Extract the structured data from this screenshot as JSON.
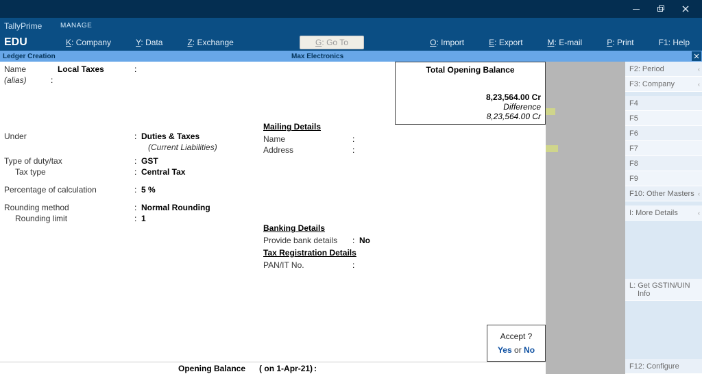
{
  "titlebar": {
    "app": "TallyPrime",
    "edition": "EDU"
  },
  "topnav": {
    "manage": "MANAGE",
    "items": {
      "company": "Company",
      "data": "Data",
      "exchange": "Exchange",
      "goto": "Go To",
      "import": "Import",
      "export": "Export",
      "email": "E-mail",
      "print": "Print",
      "help": "Help"
    },
    "keys": {
      "company": "K:",
      "data": "Y:",
      "exchange": "Z:",
      "goto": "G:",
      "import": "O:",
      "export": "E:",
      "email": "M:",
      "print": "P:",
      "help": "F1:"
    }
  },
  "subheader": {
    "left": "Ledger Creation",
    "mid": "Max Electronics"
  },
  "ledger": {
    "name_label": "Name",
    "name_value": "Local Taxes",
    "alias_label": "(alias)",
    "alias_value": "",
    "under_label": "Under",
    "under_value": "Duties & Taxes",
    "under_parent": "(Current Liabilities)",
    "duty_type_label": "Type of duty/tax",
    "duty_type_value": "GST",
    "tax_type_label": "Tax type",
    "tax_type_value": "Central Tax",
    "pct_label": "Percentage of calculation",
    "pct_value": "5 %",
    "round_method_label": "Rounding method",
    "round_method_value": "Normal Rounding",
    "round_limit_label": "Rounding limit",
    "round_limit_value": "1"
  },
  "mailing": {
    "heading": "Mailing Details",
    "name_label": "Name",
    "name_value": "",
    "address_label": "Address",
    "address_value": ""
  },
  "banking": {
    "heading": "Banking Details",
    "provide_label": "Provide bank details",
    "provide_value": "No"
  },
  "taxreg": {
    "heading": "Tax Registration Details",
    "pan_label": "PAN/IT No.",
    "pan_value": ""
  },
  "opening_box": {
    "title": "Total Opening Balance",
    "amount": "8,23,564.00 Cr",
    "diff_label": "Difference",
    "diff_value": "8,23,564.00 Cr"
  },
  "footer": {
    "label": "Opening Balance",
    "date": "( on 1-Apr-21)",
    "colon": ":"
  },
  "accept": {
    "question": "Accept ?",
    "yes": "Yes",
    "or": "or",
    "no": "No"
  },
  "right_buttons": {
    "f2": "Period",
    "f3": "Company",
    "f4": "",
    "f5": "",
    "f6": "",
    "f7": "",
    "f8": "",
    "f9": "",
    "f10": "Other Masters",
    "more": "More Details",
    "gstin1": "Get GSTIN/UIN",
    "gstin2": "Info",
    "f12": "Configure"
  },
  "right_keys": {
    "f2": "F2:",
    "f3": "F3:",
    "f4": "F4",
    "f5": "F5",
    "f6": "F6",
    "f7": "F7",
    "f8": "F8",
    "f9": "F9",
    "f10": "F10:",
    "more": "I:",
    "gstin": "L:",
    "f12": "F12:"
  }
}
